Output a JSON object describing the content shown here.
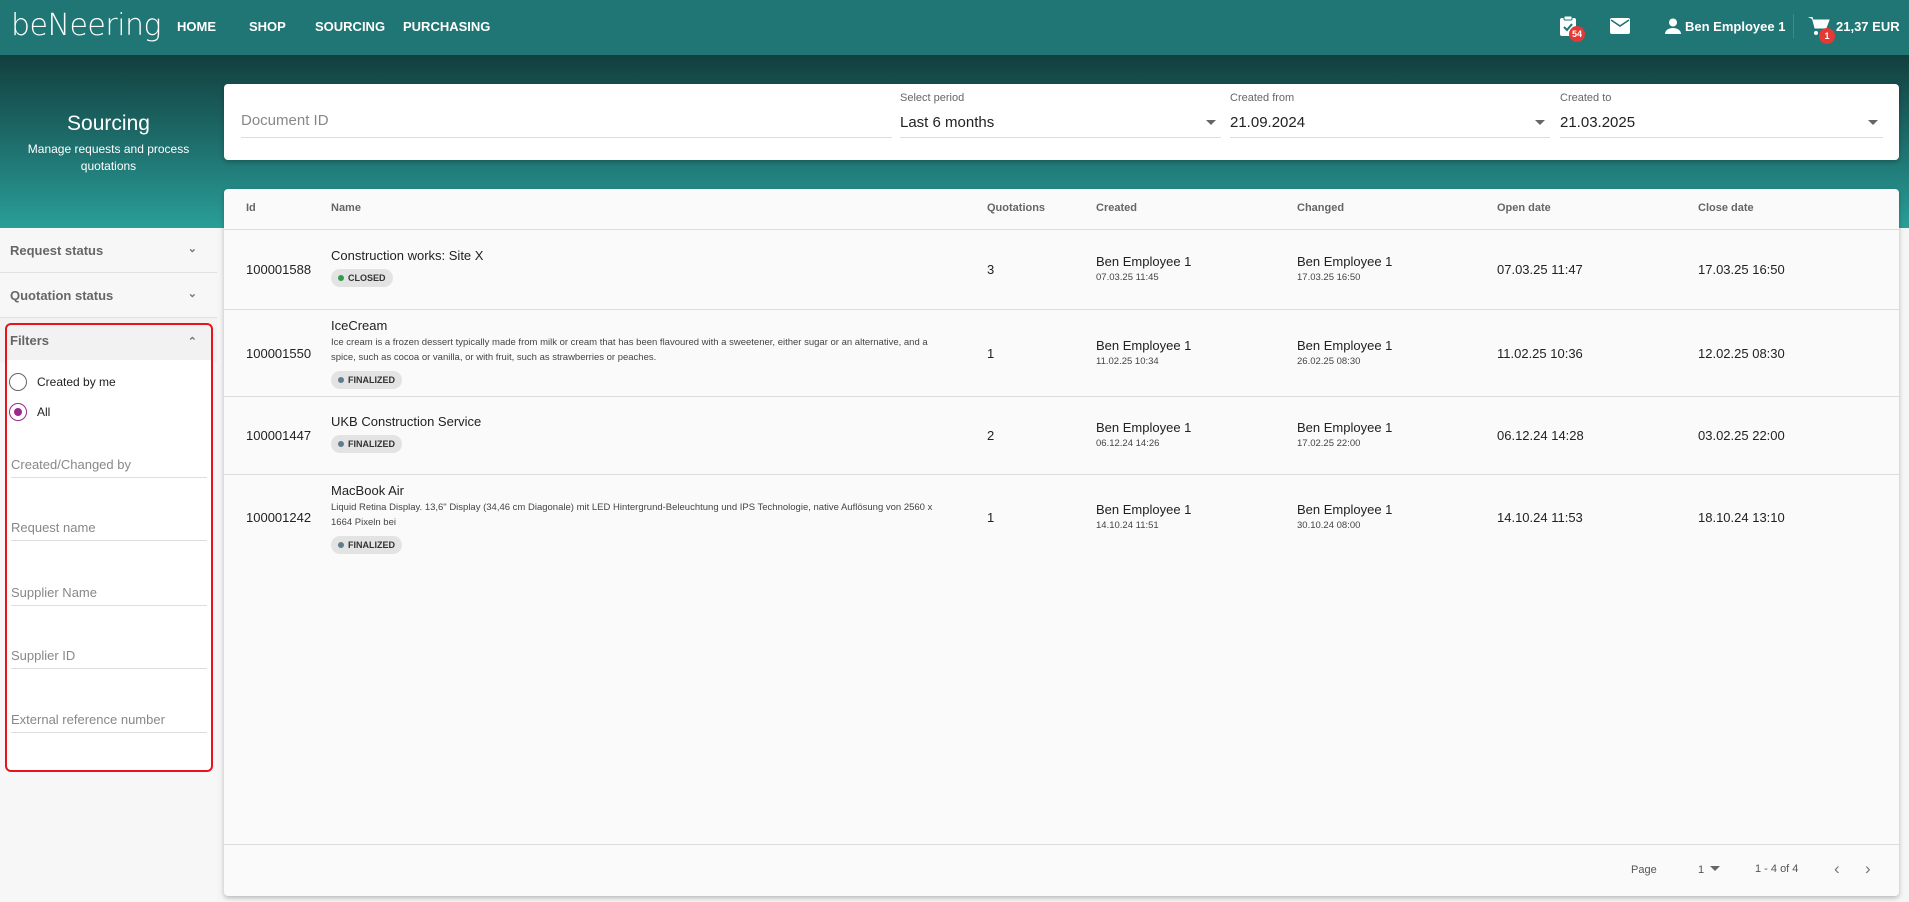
{
  "header": {
    "logo": "beNeering",
    "nav": [
      "HOME",
      "SHOP",
      "SOURCING",
      "PURCHASING"
    ],
    "tasks_badge": "54",
    "user": "Ben Employee 1",
    "cart_badge": "1",
    "cart_total": "21,37 EUR"
  },
  "hero": {
    "title": "Sourcing",
    "subtitle": "Manage requests and process quotations"
  },
  "search": {
    "document_id_placeholder": "Document ID",
    "period_label": "Select period",
    "period_value": "Last 6 months",
    "from_label": "Created from",
    "from_value": "21.09.2024",
    "to_label": "Created to",
    "to_value": "21.03.2025"
  },
  "sidebar": {
    "request_status": "Request status",
    "quotation_status": "Quotation status",
    "filters": "Filters",
    "radio_created_by_me": "Created by me",
    "radio_all": "All",
    "selected_radio": "All",
    "fields": [
      "Created/Changed by",
      "Request name",
      "Supplier Name",
      "Supplier ID",
      "External reference number"
    ]
  },
  "table": {
    "columns": [
      "Id",
      "Name",
      "Quotations",
      "Created",
      "Changed",
      "Open date",
      "Close date"
    ],
    "rows": [
      {
        "id": "100001588",
        "name": "Construction works: Site X",
        "desc": "",
        "status": "CLOSED",
        "status_color": "#2e9e4a",
        "quotations": "3",
        "created_by": "Ben Employee 1",
        "created_at": "07.03.25 11:45",
        "changed_by": "Ben Employee 1",
        "changed_at": "17.03.25 16:50",
        "open": "07.03.25 11:47",
        "close": "17.03.25 16:50"
      },
      {
        "id": "100001550",
        "name": "IceCream",
        "desc": "Ice cream is a frozen dessert typically made from milk or cream that has been flavoured with a sweetener, either sugar or an alternative, and a spice, such as cocoa or vanilla, or with fruit, such as strawberries or peaches.",
        "status": "FINALIZED",
        "status_color": "#607d8b",
        "quotations": "1",
        "created_by": "Ben Employee 1",
        "created_at": "11.02.25 10:34",
        "changed_by": "Ben Employee 1",
        "changed_at": "26.02.25 08:30",
        "open": "11.02.25 10:36",
        "close": "12.02.25 08:30"
      },
      {
        "id": "100001447",
        "name": "UKB Construction Service",
        "desc": "",
        "status": "FINALIZED",
        "status_color": "#607d8b",
        "quotations": "2",
        "created_by": "Ben Employee 1",
        "created_at": "06.12.24 14:26",
        "changed_by": "Ben Employee 1",
        "changed_at": "17.02.25 22:00",
        "open": "06.12.24 14:28",
        "close": "03.02.25 22:00"
      },
      {
        "id": "100001242",
        "name": "MacBook Air",
        "desc": "Liquid Retina Display. 13,6\" Display (34,46 cm Diagonale) mit LED Hintergrund-Beleuchtung und IPS Technologie, native Auflösung von 2560 x 1664 Pixeln bei",
        "status": "FINALIZED",
        "status_color": "#607d8b",
        "quotations": "1",
        "created_by": "Ben Employee 1",
        "created_at": "14.10.24 11:51",
        "changed_by": "Ben Employee 1",
        "changed_at": "30.10.24 08:00",
        "open": "14.10.24 11:53",
        "close": "18.10.24 13:10"
      }
    ]
  },
  "pagination": {
    "page_label": "Page",
    "page": "1",
    "range": "1 - 4 of 4"
  }
}
